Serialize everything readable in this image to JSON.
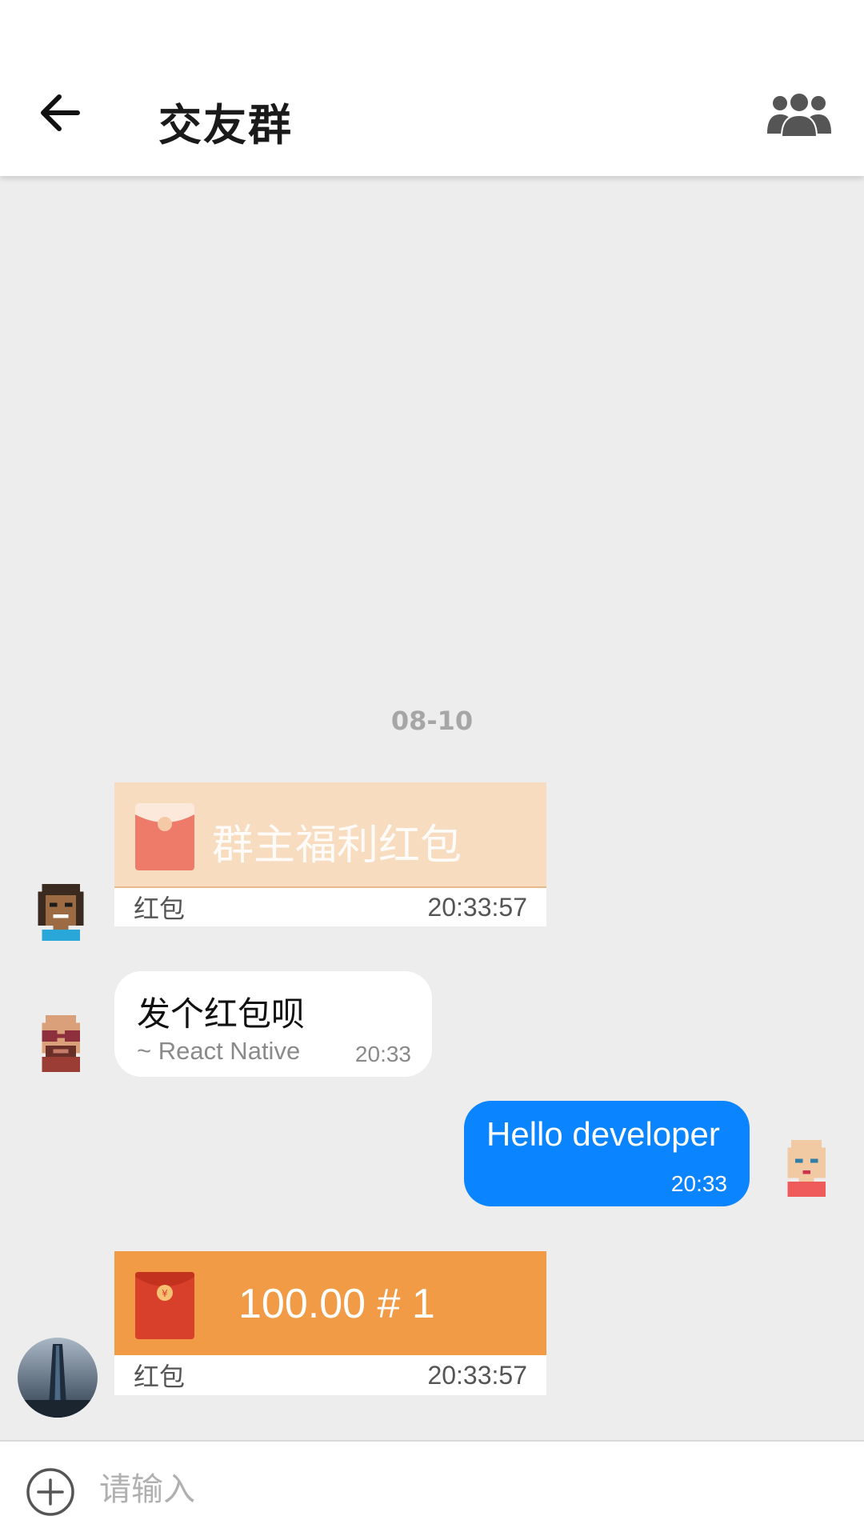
{
  "header": {
    "back_icon": "arrow-left-icon",
    "title": "交友群",
    "members_icon": "group-icon"
  },
  "chat": {
    "date_divider": "08-10",
    "messages": [
      {
        "type": "red_packet",
        "side": "left",
        "avatar": "pixel-avatar-girl",
        "text": "群主福利红包",
        "label": "红包",
        "time": "20:33:57",
        "opened": true,
        "color": "#f7dcc0"
      },
      {
        "type": "text",
        "side": "left",
        "avatar": "pixel-avatar-sunglasses",
        "text": "发个红包呗",
        "sender": "~ React Native",
        "time": "20:33"
      },
      {
        "type": "text",
        "side": "right",
        "avatar": "pixel-avatar-bald",
        "text": "Hello developer",
        "time": "20:33",
        "color": "#0b84ff"
      },
      {
        "type": "red_packet",
        "side": "left",
        "avatar": "photo-avatar-tower",
        "text": "100.00 # 1",
        "label": "红包",
        "time": "20:33:57",
        "opened": false,
        "color": "#f19b47"
      }
    ]
  },
  "composer": {
    "plus_icon": "plus-circle-icon",
    "placeholder": "请输入"
  }
}
